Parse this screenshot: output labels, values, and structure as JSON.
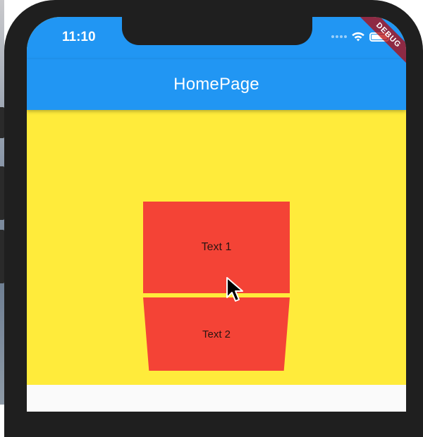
{
  "status_bar": {
    "time": "11:10",
    "icons": [
      "signal-dots-icon",
      "wifi-icon",
      "battery-icon"
    ]
  },
  "app_bar": {
    "title": "HomePage"
  },
  "debug_banner": {
    "label": "DEBUG"
  },
  "content": {
    "boxes": [
      {
        "label": "Text 1"
      },
      {
        "label": "Text 2"
      }
    ]
  },
  "colors": {
    "app_bar": "#2196f3",
    "background": "#ffeb3b",
    "box": "#f44336",
    "debug_banner": "#b80000"
  }
}
